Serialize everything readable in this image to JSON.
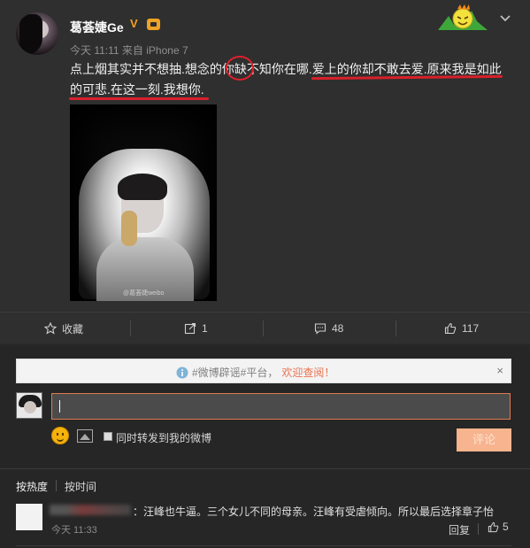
{
  "post": {
    "author": "葛荟婕Ge",
    "verified_badge": "V",
    "meta": "今天 11:11 来自 iPhone 7",
    "text": "点上烟其实并不想抽.想念的你缺不知你在哪.爱上的你却不敢去爱.原来我是如此的可悲.在这一刻.我想你.",
    "image_watermark": "@葛荟婕weibo",
    "annotation_color": "#e2202a"
  },
  "actions": {
    "favorite": {
      "icon": "star-icon",
      "label": "收藏"
    },
    "repost": {
      "icon": "repost-icon",
      "count": "1"
    },
    "comment": {
      "icon": "comment-icon",
      "count": "48"
    },
    "like": {
      "icon": "thumbs-up-icon",
      "count": "117"
    }
  },
  "comment_box": {
    "notice_prefix": "#微博辟谣#平台，",
    "notice_link": "欢迎查阅！",
    "notice_close": "×",
    "input_value": "",
    "also_repost_label": "同时转发到我的微博",
    "submit_label": "评论",
    "accent": "#eb7350"
  },
  "sort": {
    "hot": "按热度",
    "time": "按时间"
  },
  "comments": [
    {
      "text": "：汪峰也牛逼。三个女儿不同的母亲。汪峰有受虐倾向。所以最后选择章子怡",
      "time": "今天 11:33",
      "reply_label": "回复",
      "likes": "5"
    }
  ]
}
